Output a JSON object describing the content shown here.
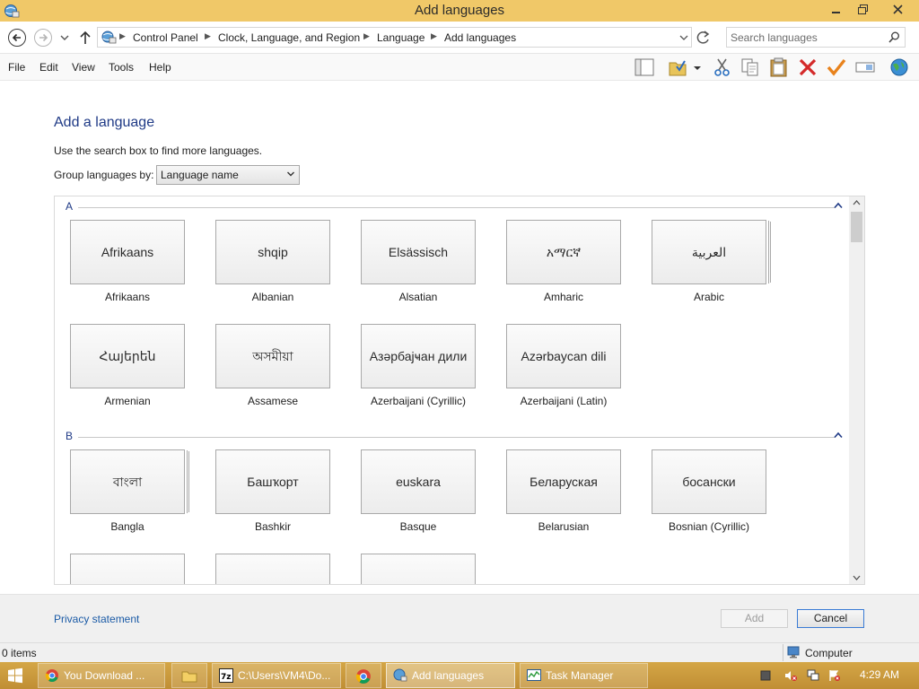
{
  "window": {
    "title": "Add languages"
  },
  "address_bar": {
    "breadcrumbs": [
      "Control Panel",
      "Clock, Language, and Region",
      "Language",
      "Add languages"
    ],
    "search_placeholder": "Search languages"
  },
  "menu": {
    "items": [
      "File",
      "Edit",
      "View",
      "Tools",
      "Help"
    ]
  },
  "toolbar": {
    "icons": [
      "layout-pane-icon",
      "folder-check-icon",
      "dropdown-arrow-icon",
      "scissors-icon",
      "copy-icon",
      "paste-icon",
      "delete-icon",
      "checkmark-icon",
      "rename-icon",
      "globe-icon"
    ]
  },
  "page": {
    "heading": "Add a language",
    "help_text": "Use the search box to find more languages.",
    "group_by_label": "Group languages by:",
    "group_by_value": "Language name"
  },
  "groups": [
    {
      "letter": "A",
      "languages": [
        {
          "native": "Afrikaans",
          "name": "Afrikaans",
          "stacked": false
        },
        {
          "native": "shqip",
          "name": "Albanian",
          "stacked": false
        },
        {
          "native": "Elsässisch",
          "name": "Alsatian",
          "stacked": false
        },
        {
          "native": "አማርኛ",
          "name": "Amharic",
          "stacked": false
        },
        {
          "native": "العربية",
          "name": "Arabic",
          "stacked": true
        },
        {
          "native": "Հայերեն",
          "name": "Armenian",
          "stacked": false
        },
        {
          "native": "অসমীয়া",
          "name": "Assamese",
          "stacked": false
        },
        {
          "native": "Азәрбајҹан дили",
          "name": "Azerbaijani (Cyrillic)",
          "stacked": false
        },
        {
          "native": "Azərbaycan dili",
          "name": "Azerbaijani (Latin)",
          "stacked": false
        }
      ]
    },
    {
      "letter": "B",
      "languages": [
        {
          "native": "বাংলা",
          "name": "Bangla",
          "stacked": true
        },
        {
          "native": "Башҡорт",
          "name": "Bashkir",
          "stacked": false
        },
        {
          "native": "euskara",
          "name": "Basque",
          "stacked": false
        },
        {
          "native": "Беларуская",
          "name": "Belarusian",
          "stacked": false
        },
        {
          "native": "босански",
          "name": "Bosnian (Cyrillic)",
          "stacked": false
        }
      ]
    }
  ],
  "footer": {
    "privacy_link": "Privacy statement",
    "add_button": "Add",
    "cancel_button": "Cancel"
  },
  "status_bar": {
    "items_count": "0 items",
    "location": "Computer"
  },
  "taskbar": {
    "tasks": [
      {
        "label": "You Download ...",
        "icon": "chrome-icon",
        "active": false
      },
      {
        "label": "C:\\Users\\VM4\\Do...",
        "icon": "7zip-icon",
        "active": false
      },
      {
        "label": "Add languages",
        "icon": "control-panel-icon",
        "active": true
      },
      {
        "label": "Task Manager",
        "icon": "task-manager-icon",
        "active": false
      }
    ],
    "clock": "4:29 AM"
  },
  "colors": {
    "title_bar": "#f0c868",
    "taskbar": "#c8983c",
    "heading": "#1f3a86",
    "link": "#1a5aa6"
  }
}
